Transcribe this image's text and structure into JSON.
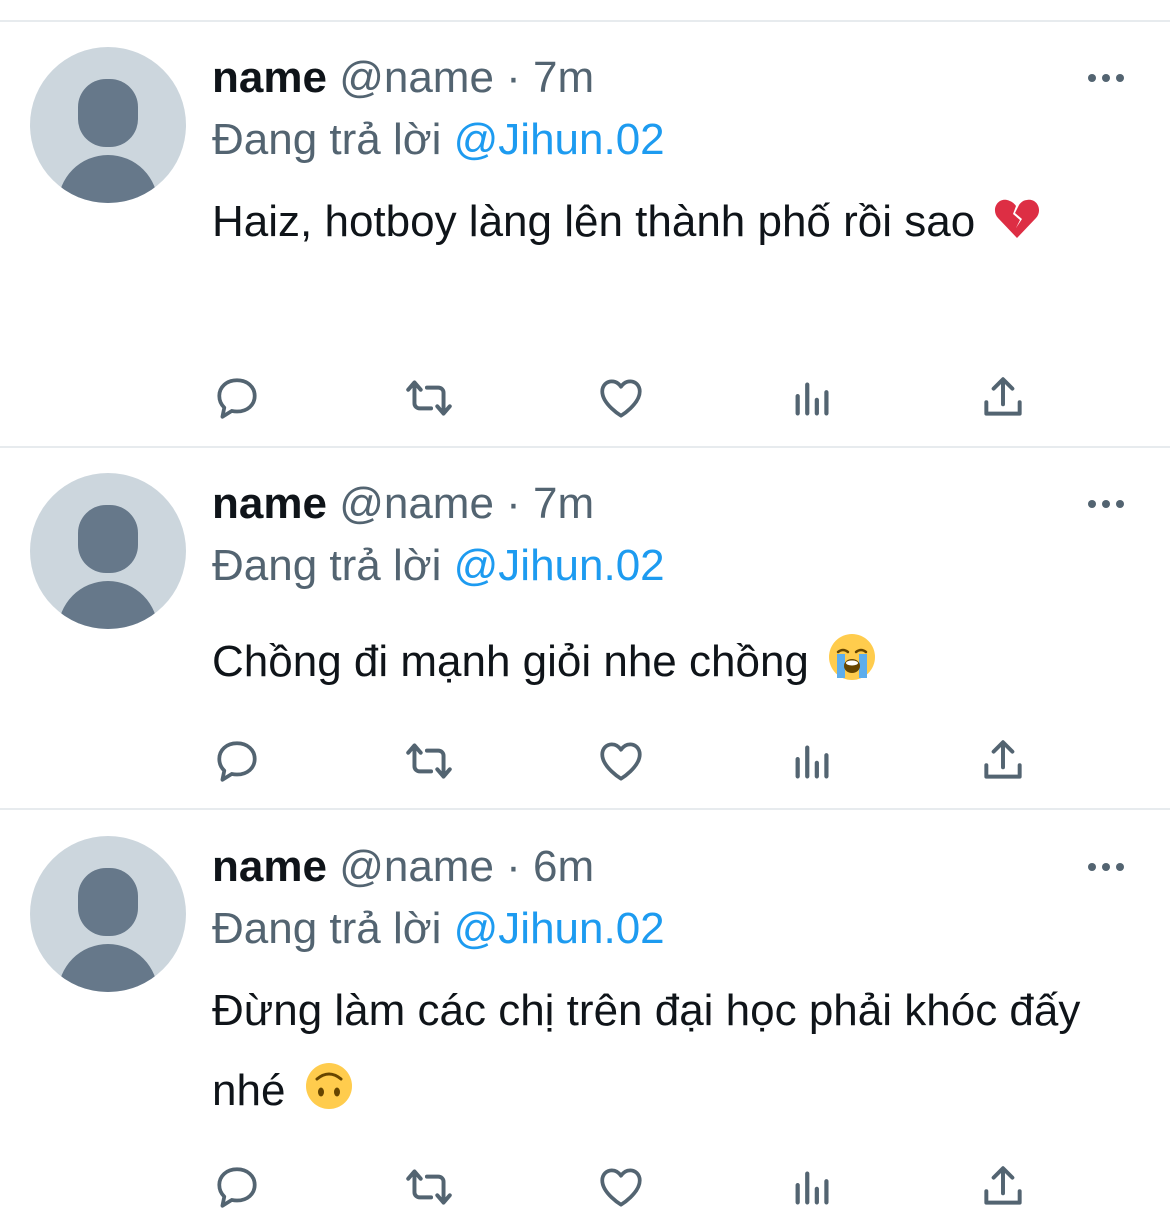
{
  "tweets": [
    {
      "display_name": "name",
      "handle": "@name",
      "separator": "·",
      "time": "7m",
      "reply_prefix": "Đang trả lời",
      "reply_to": "@Jihun.02",
      "text": "Haiz, hotboy làng lên thành phố rồi sao",
      "emoji": "broken-heart"
    },
    {
      "display_name": "name",
      "handle": "@name",
      "separator": "·",
      "time": "7m",
      "reply_prefix": "Đang trả lời",
      "reply_to": "@Jihun.02",
      "text": "Chồng đi mạnh giỏi nhe chồng",
      "emoji": "loudly-crying-face"
    },
    {
      "display_name": "name",
      "handle": "@name",
      "separator": "·",
      "time": "6m",
      "reply_prefix": "Đang trả lời",
      "reply_to": "@Jihun.02",
      "text": "Đừng làm các chị trên đại học phải khóc đấy nhé",
      "emoji": "upside-down-face"
    }
  ],
  "actions": [
    "reply-icon",
    "retweet-icon",
    "like-icon",
    "analytics-icon",
    "share-icon"
  ],
  "colors": {
    "text_primary": "#0f1419",
    "text_secondary": "#536471",
    "link": "#1d9bf0",
    "divider": "#e7ebee",
    "icon": "#536471",
    "avatar_bg": "#ccd6dd",
    "avatar_fg": "#66788a"
  }
}
